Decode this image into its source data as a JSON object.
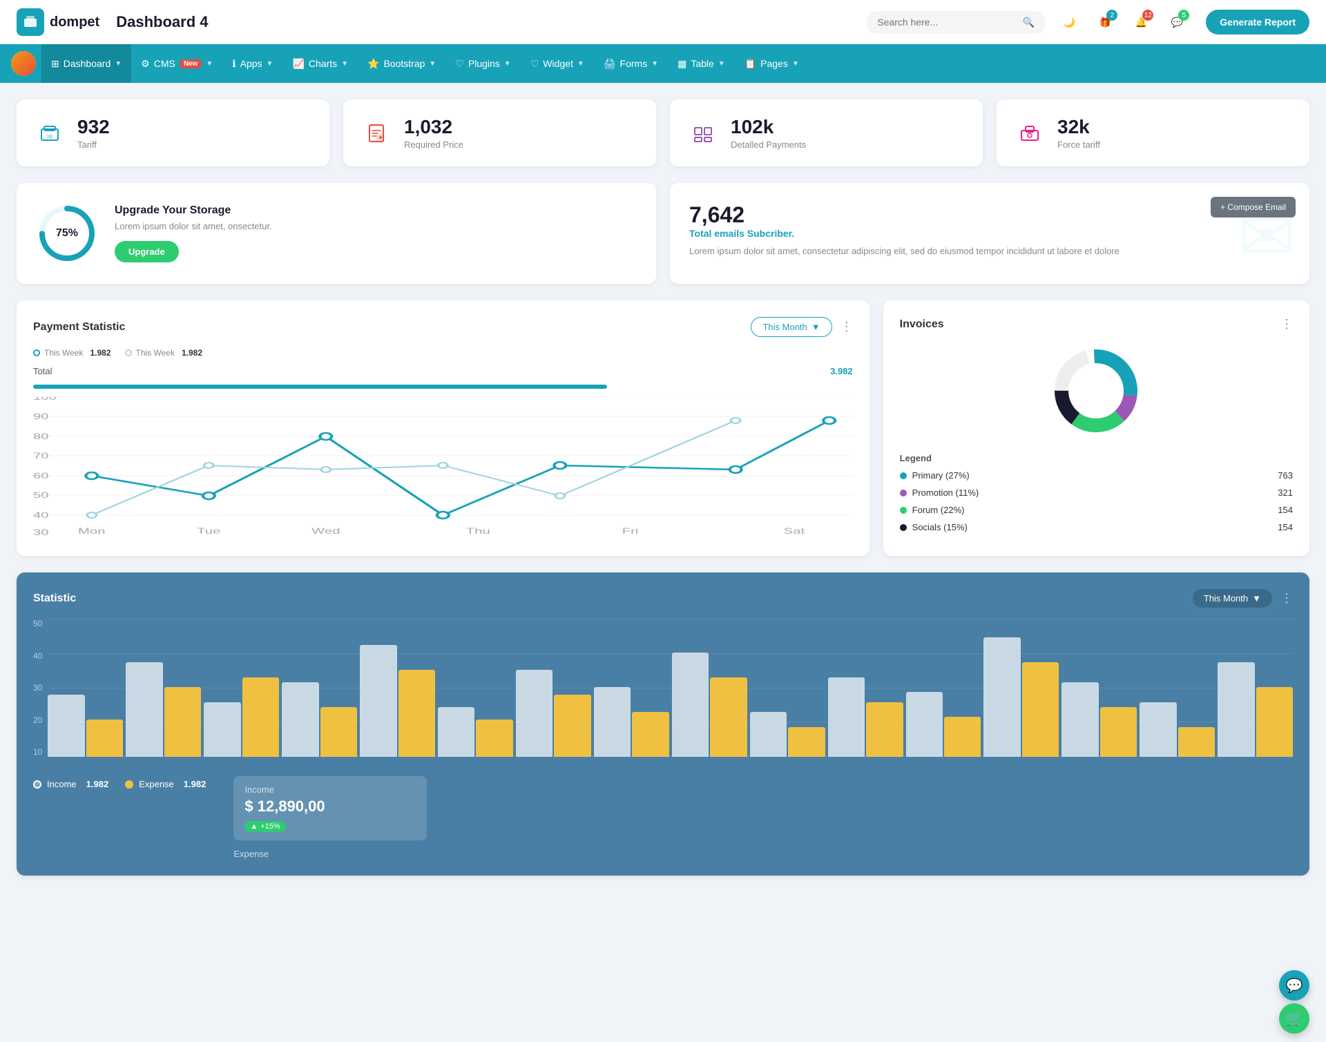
{
  "header": {
    "logo_text": "dompet",
    "page_title": "Dashboard 4",
    "search_placeholder": "Search here...",
    "generate_btn": "Generate Report",
    "icons": {
      "moon": "🌙",
      "gift_badge": "2",
      "bell_badge": "12",
      "chat_badge": "5"
    }
  },
  "nav": {
    "items": [
      {
        "label": "Dashboard",
        "has_arrow": true,
        "active": true
      },
      {
        "label": "CMS",
        "has_arrow": true,
        "badge": "New"
      },
      {
        "label": "Apps",
        "has_arrow": true
      },
      {
        "label": "Charts",
        "has_arrow": true
      },
      {
        "label": "Bootstrap",
        "has_arrow": true
      },
      {
        "label": "Plugins",
        "has_arrow": true
      },
      {
        "label": "Widget",
        "has_arrow": true
      },
      {
        "label": "Forms",
        "has_arrow": true
      },
      {
        "label": "Table",
        "has_arrow": true
      },
      {
        "label": "Pages",
        "has_arrow": true
      }
    ]
  },
  "stats": [
    {
      "number": "932",
      "label": "Tariff",
      "icon": "🏢",
      "color": "teal"
    },
    {
      "number": "1,032",
      "label": "Required Price",
      "icon": "📄",
      "color": "red"
    },
    {
      "number": "102k",
      "label": "Detalled Payments",
      "icon": "📊",
      "color": "purple"
    },
    {
      "number": "32k",
      "label": "Force tariff",
      "icon": "🏗️",
      "color": "pink"
    }
  ],
  "storage": {
    "percent": 75,
    "percent_label": "75%",
    "title": "Upgrade Your Storage",
    "description": "Lorem ipsum dolor sit amet, onsectetur.",
    "button_label": "Upgrade"
  },
  "email": {
    "count": "7,642",
    "sub_label": "Total emails Subcriber.",
    "description": "Lorem ipsum dolor sit amet, consectetur adipiscing elit, sed do eiusmod tempor incididunt ut labore et dolore",
    "compose_btn": "+ Compose Email"
  },
  "payment": {
    "title": "Payment Statistic",
    "filter": "This Month",
    "legend1_label": "This Week",
    "legend1_value": "1.982",
    "legend2_label": "This Week",
    "legend2_value": "1.982",
    "total_label": "Total",
    "total_value": "3.982",
    "x_labels": [
      "Mon",
      "Tue",
      "Wed",
      "Thu",
      "Fri",
      "Sat"
    ],
    "y_labels": [
      "100",
      "90",
      "80",
      "70",
      "60",
      "50",
      "40",
      "30"
    ],
    "line1": [
      60,
      50,
      80,
      40,
      65,
      63,
      88
    ],
    "line2": [
      40,
      70,
      67,
      65,
      50,
      88
    ]
  },
  "invoices": {
    "title": "Invoices",
    "donut": {
      "segments": [
        {
          "label": "Primary (27%)",
          "color": "#17a2b8",
          "value": 763,
          "percent": 27
        },
        {
          "label": "Promotion (11%)",
          "color": "#9b59b6",
          "value": 321,
          "percent": 11
        },
        {
          "label": "Forum (22%)",
          "color": "#2ecc71",
          "value": 154,
          "percent": 22
        },
        {
          "label": "Socials (15%)",
          "color": "#1a1a2e",
          "value": 154,
          "percent": 15
        }
      ]
    }
  },
  "statistic": {
    "title": "Statistic",
    "filter": "This Month",
    "income_label": "Income",
    "income_value": "1.982",
    "expense_label": "Expense",
    "expense_value": "1.982",
    "income_amount": "$ 12,890,00",
    "income_change": "+15%",
    "expense_title": "Expense",
    "bars": [
      25,
      38,
      22,
      30,
      45,
      20,
      35,
      28,
      42,
      18,
      32,
      26,
      48,
      30,
      22,
      38
    ],
    "bars2": [
      15,
      28,
      32,
      20,
      35,
      15,
      25,
      18,
      32,
      12,
      22,
      16,
      38,
      20,
      12,
      28
    ]
  }
}
